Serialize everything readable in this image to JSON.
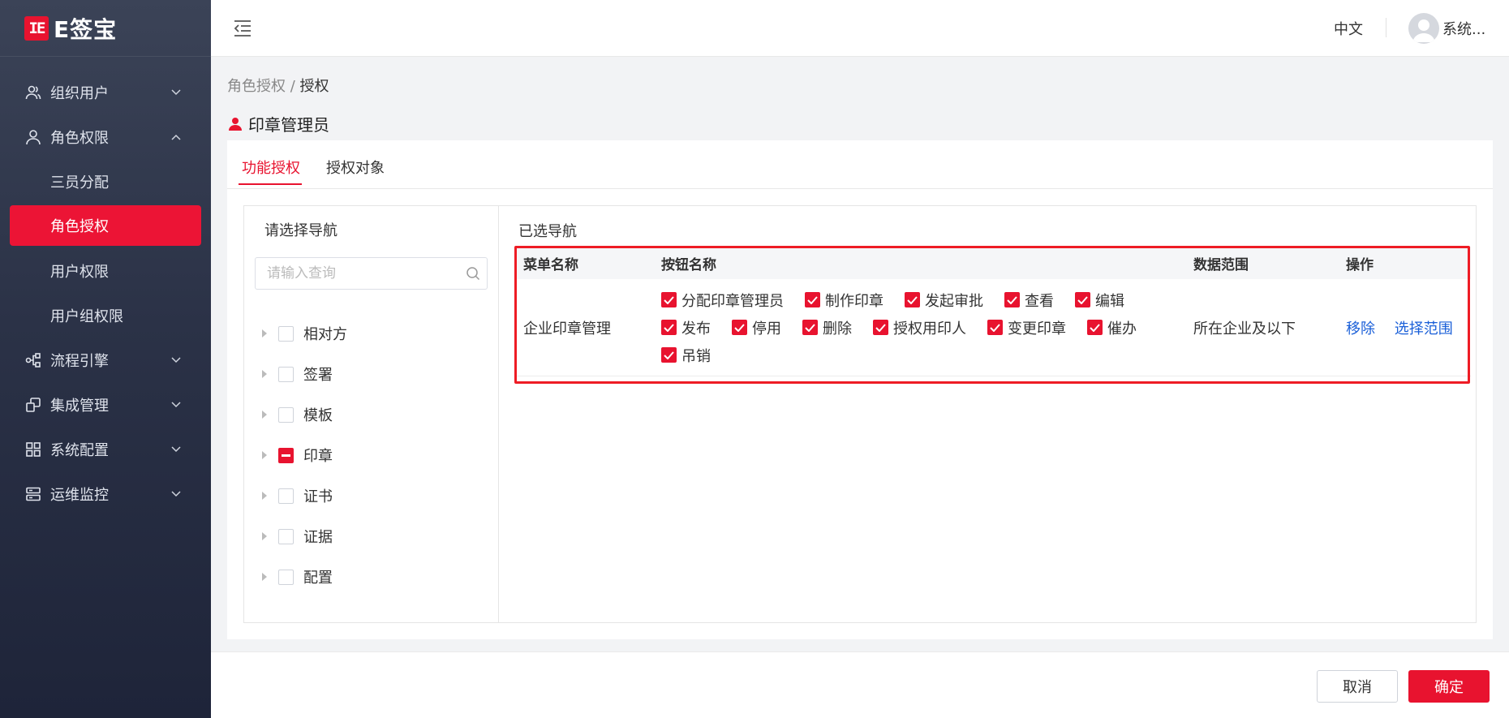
{
  "app": {
    "logo_mark": "IE",
    "logo_text": "E签宝"
  },
  "sidebar": {
    "items": [
      {
        "label": "组织用户",
        "icon": "users-icon",
        "expanded": false
      },
      {
        "label": "角色权限",
        "icon": "user-icon",
        "expanded": true,
        "children": [
          {
            "label": "三员分配"
          },
          {
            "label": "角色授权",
            "active": true
          },
          {
            "label": "用户权限"
          },
          {
            "label": "用户组权限"
          }
        ]
      },
      {
        "label": "流程引擎",
        "icon": "flow-icon",
        "expanded": false
      },
      {
        "label": "集成管理",
        "icon": "integration-icon",
        "expanded": false
      },
      {
        "label": "系统配置",
        "icon": "grid-icon",
        "expanded": false
      },
      {
        "label": "运维监控",
        "icon": "server-icon",
        "expanded": false
      }
    ]
  },
  "header": {
    "lang": "中文",
    "username": "系统..."
  },
  "breadcrumb": {
    "parent": "角色授权",
    "separator": "/",
    "current": "授权"
  },
  "role": {
    "name": "印章管理员"
  },
  "tabs": [
    {
      "label": "功能授权",
      "active": true
    },
    {
      "label": "授权对象",
      "active": false
    }
  ],
  "left_panel": {
    "title": "请选择导航",
    "search_placeholder": "请输入查询",
    "tree": [
      {
        "label": "相对方",
        "state": "unchecked"
      },
      {
        "label": "签署",
        "state": "unchecked"
      },
      {
        "label": "模板",
        "state": "unchecked"
      },
      {
        "label": "印章",
        "state": "indeterminate"
      },
      {
        "label": "证书",
        "state": "unchecked"
      },
      {
        "label": "证据",
        "state": "unchecked"
      },
      {
        "label": "配置",
        "state": "unchecked"
      }
    ]
  },
  "right_panel": {
    "title": "已选导航",
    "columns": {
      "menu": "菜单名称",
      "buttons": "按钮名称",
      "scope": "数据范围",
      "ops": "操作"
    },
    "rows": [
      {
        "menu": "企业印章管理",
        "buttons": [
          "分配印章管理员",
          "制作印章",
          "发起审批",
          "查看",
          "编辑",
          "发布",
          "停用",
          "删除",
          "授权用印人",
          "变更印章",
          "催办",
          "吊销"
        ],
        "scope": "所在企业及以下",
        "ops": {
          "remove": "移除",
          "select_scope": "选择范围"
        }
      }
    ]
  },
  "footer": {
    "cancel": "取消",
    "ok": "确定"
  },
  "colors": {
    "brand": "#e8132f",
    "link": "#1a5fd8",
    "sidebar_bg": "#2b3247"
  }
}
